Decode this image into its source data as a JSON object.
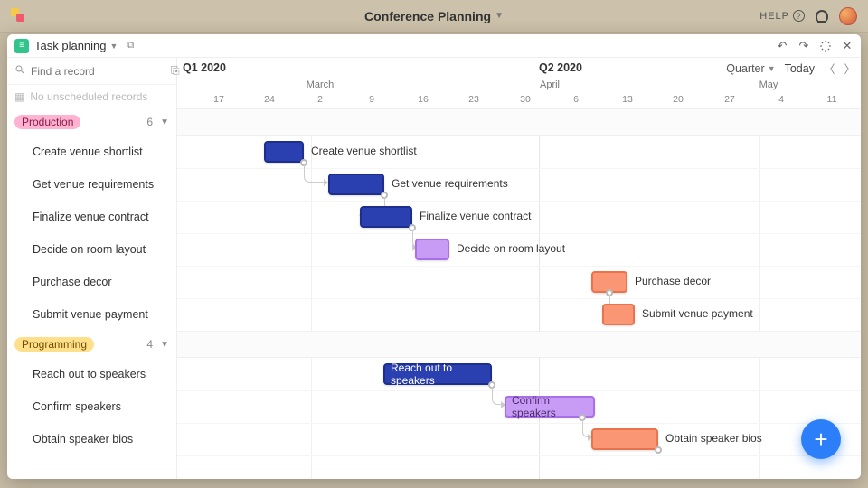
{
  "app": {
    "title": "Conference Planning",
    "help": "HELP"
  },
  "view": {
    "name": "Task planning"
  },
  "find_placeholder": "Find a record",
  "unscheduled": "No unscheduled records",
  "toolbar": {
    "scale": "Quarter",
    "today": "Today"
  },
  "quarters": {
    "q1": "Q1 2020",
    "q2": "Q2 2020"
  },
  "months": {
    "mar": "March",
    "apr": "April",
    "may": "May"
  },
  "days": [
    "17",
    "24",
    "2",
    "9",
    "16",
    "23",
    "30",
    "6",
    "13",
    "20",
    "27",
    "4",
    "11"
  ],
  "groups": [
    {
      "name": "Production",
      "count": "6",
      "color": "pink",
      "tasks": [
        {
          "name": "Create venue shortlist"
        },
        {
          "name": "Get venue requirements"
        },
        {
          "name": "Finalize venue contract"
        },
        {
          "name": "Decide on room layout"
        },
        {
          "name": "Purchase decor"
        },
        {
          "name": "Submit venue payment"
        }
      ]
    },
    {
      "name": "Programming",
      "count": "4",
      "color": "yellow",
      "tasks": [
        {
          "name": "Reach out to speakers"
        },
        {
          "name": "Confirm speakers"
        },
        {
          "name": "Obtain speaker bios"
        }
      ]
    }
  ],
  "bars": {
    "create_venue": "Create venue shortlist",
    "get_req": "Get venue requirements",
    "finalize": "Finalize venue contract",
    "room": "Decide on room layout",
    "decor": "Purchase decor",
    "payment": "Submit venue payment",
    "reach": "Reach out to speakers",
    "confirm": "Confirm speakers",
    "bios": "Obtain speaker bios"
  }
}
